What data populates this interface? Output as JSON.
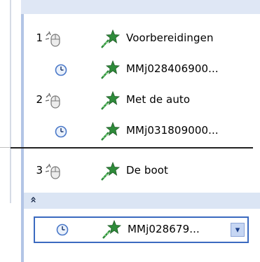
{
  "animation_pane": {
    "items": [
      {
        "index": "1",
        "trigger": "mouse",
        "label": "Voorbereidingen"
      },
      {
        "index": "",
        "trigger": "clock",
        "label": "MMj028406900..."
      },
      {
        "index": "2",
        "trigger": "mouse",
        "label": "Met de auto"
      },
      {
        "index": "",
        "trigger": "clock",
        "label": "MMj031809000..."
      },
      {
        "index": "3",
        "trigger": "mouse",
        "label": "De boot"
      }
    ],
    "collapse_glyph": "»",
    "selected_item": {
      "trigger": "clock",
      "label": "MMj028679...",
      "dropdown_glyph": "▾"
    }
  },
  "icons": {
    "mouse": "mouse-click-icon",
    "clock": "clock-icon",
    "effect": "green-star-effect-icon",
    "collapse": "double-chevron-up-icon",
    "dropdown": "chevron-down-icon"
  },
  "colors": {
    "header_band": "#dfe7f5",
    "collapse_band": "#dbe5f4",
    "selection_border": "#3b6ac0",
    "star_green": "#2e8b3a",
    "clock_blue": "#4a78c8"
  }
}
